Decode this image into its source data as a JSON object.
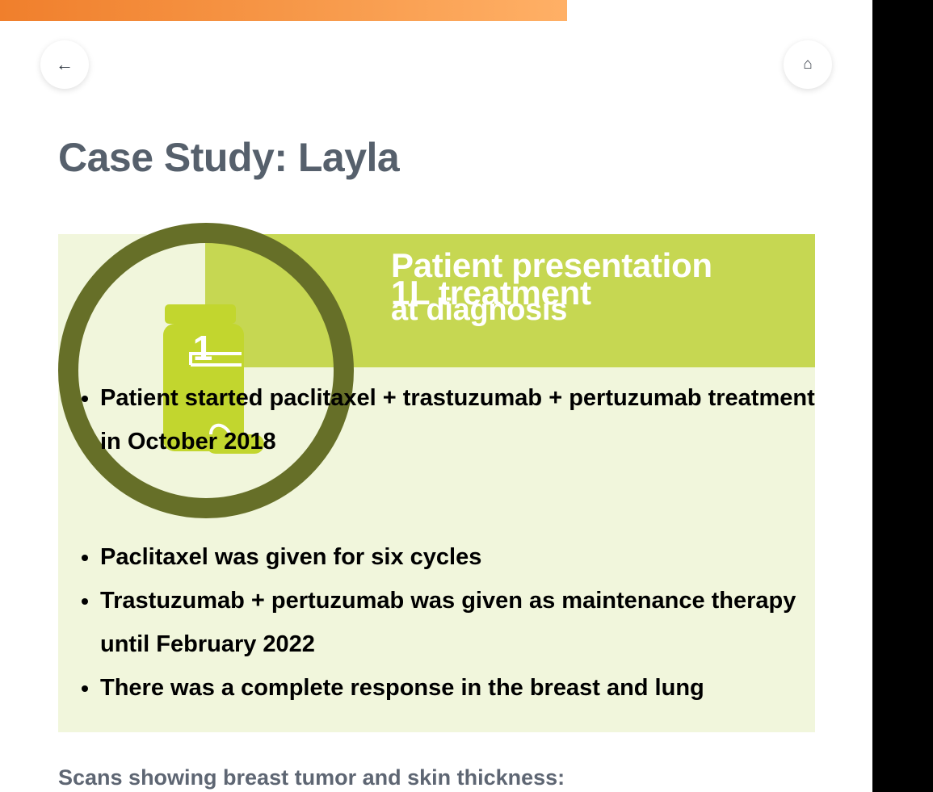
{
  "progress": {
    "percent": 65
  },
  "nav": {
    "back_icon": "←",
    "home_icon": "⌂"
  },
  "title": "Case Study: Layla",
  "card": {
    "heading_lines": [
      "Patient presentation",
      "1L treatment",
      "at diagnosis"
    ],
    "badge_icon": "vial-icon",
    "badge_number": "1",
    "bullets": [
      "Patient started paclitaxel + trastuzumab + pertuzumab treatment in October 2018",
      "Paclitaxel was given for six cycles",
      "Trastuzumab + pertuzumab was given as maintenance therapy until February 2022",
      "There was a complete response in the breast and lung"
    ]
  },
  "scans_label": "Scans showing breast tumor and skin thickness:",
  "colors": {
    "accent_orange": "#f07f2c",
    "header_green": "#c6d752",
    "card_tint": "#f1f6dc",
    "ring_olive": "#666f28",
    "vial_green": "#c2d62e",
    "title_gray": "#56606c"
  }
}
